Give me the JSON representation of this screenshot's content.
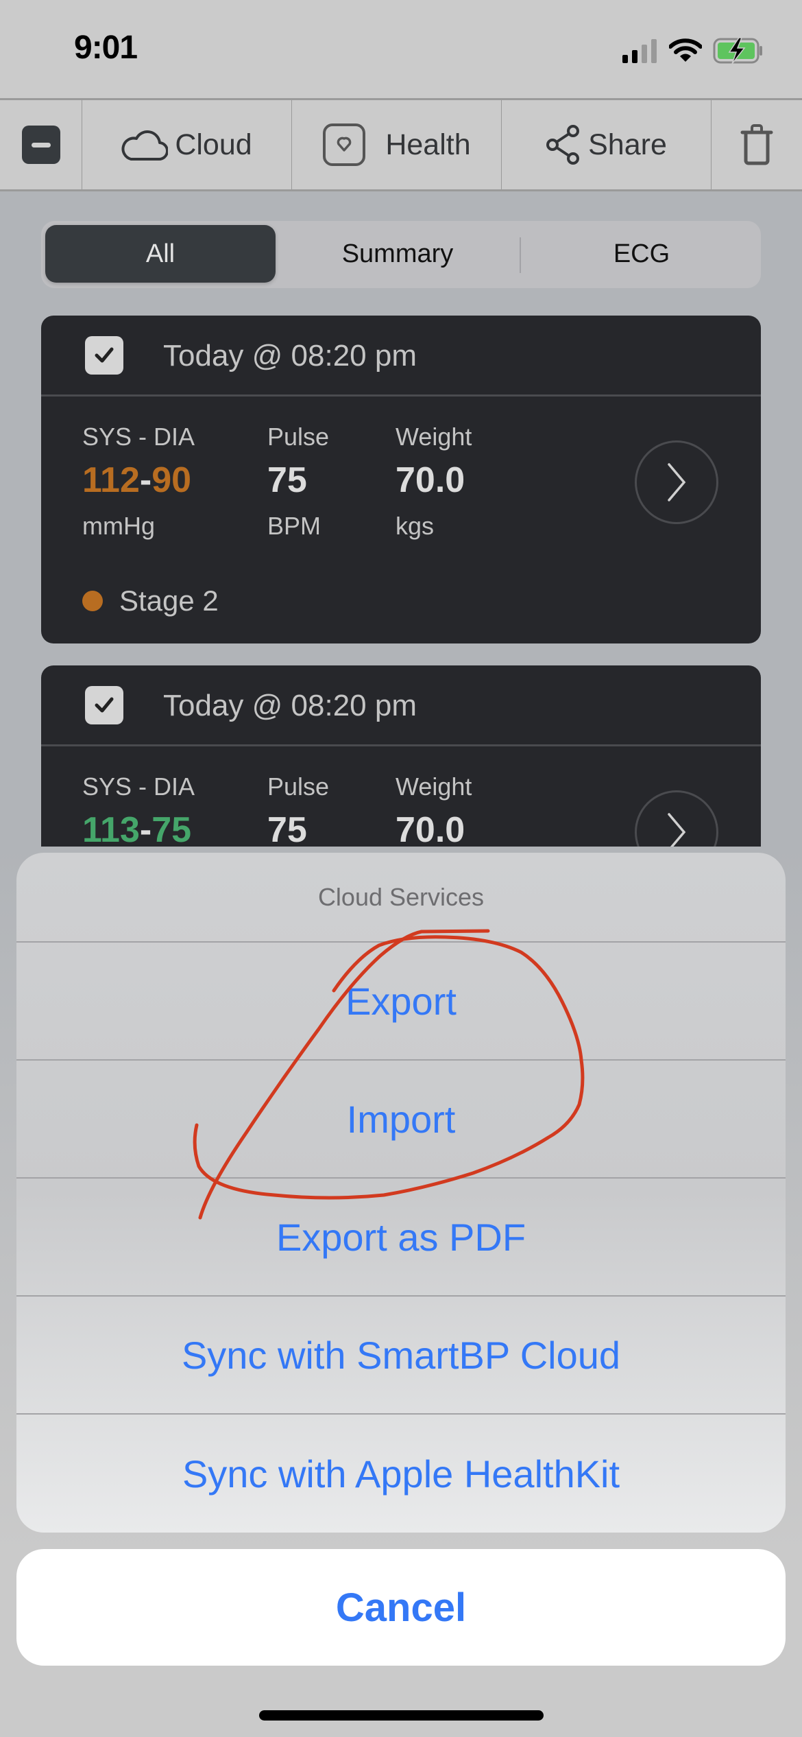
{
  "status_bar": {
    "time": "9:01",
    "icons": [
      "cellular-signal-icon",
      "wifi-icon",
      "battery-charging-icon"
    ]
  },
  "toolbar": {
    "items": [
      {
        "icon": "minus-square-icon",
        "label": ""
      },
      {
        "icon": "cloud-icon",
        "label": "Cloud"
      },
      {
        "icon": "health-heart-icon",
        "label": "Health"
      },
      {
        "icon": "share-icon",
        "label": "Share"
      },
      {
        "icon": "trash-icon",
        "label": ""
      }
    ]
  },
  "segmented": {
    "options": [
      "All",
      "Summary",
      "ECG"
    ],
    "selected": "All"
  },
  "readings": [
    {
      "checked": true,
      "date": "Today @ 08:20 pm",
      "sys_dia_label": "SYS - DIA",
      "sys": "112",
      "dia": "90",
      "dash": "-",
      "bp_unit": "mmHg",
      "pulse_label": "Pulse",
      "pulse": "75",
      "pulse_unit": "BPM",
      "weight_label": "Weight",
      "weight": "70.0",
      "weight_unit": "kgs",
      "stage": "Stage 2",
      "color": "#b86d21"
    },
    {
      "checked": true,
      "date": "Today @ 08:20 pm",
      "sys_dia_label": "SYS - DIA",
      "sys": "113",
      "dia": "75",
      "dash": "-",
      "pulse_label": "Pulse",
      "pulse": "75",
      "weight_label": "Weight",
      "weight": "70.0",
      "color": "#45a66a"
    }
  ],
  "action_sheet": {
    "title": "Cloud Services",
    "options": [
      "Export",
      "Import",
      "Export as PDF",
      "Sync with SmartBP Cloud",
      "Sync with Apple HealthKit"
    ],
    "cancel": "Cancel",
    "annotation": "red hand-drawn circle around Export"
  },
  "colors": {
    "accent_blue": "#3478f6",
    "annotation_red": "#d23a1f",
    "stage2_orange": "#b86d21",
    "normal_green": "#45a66a"
  }
}
